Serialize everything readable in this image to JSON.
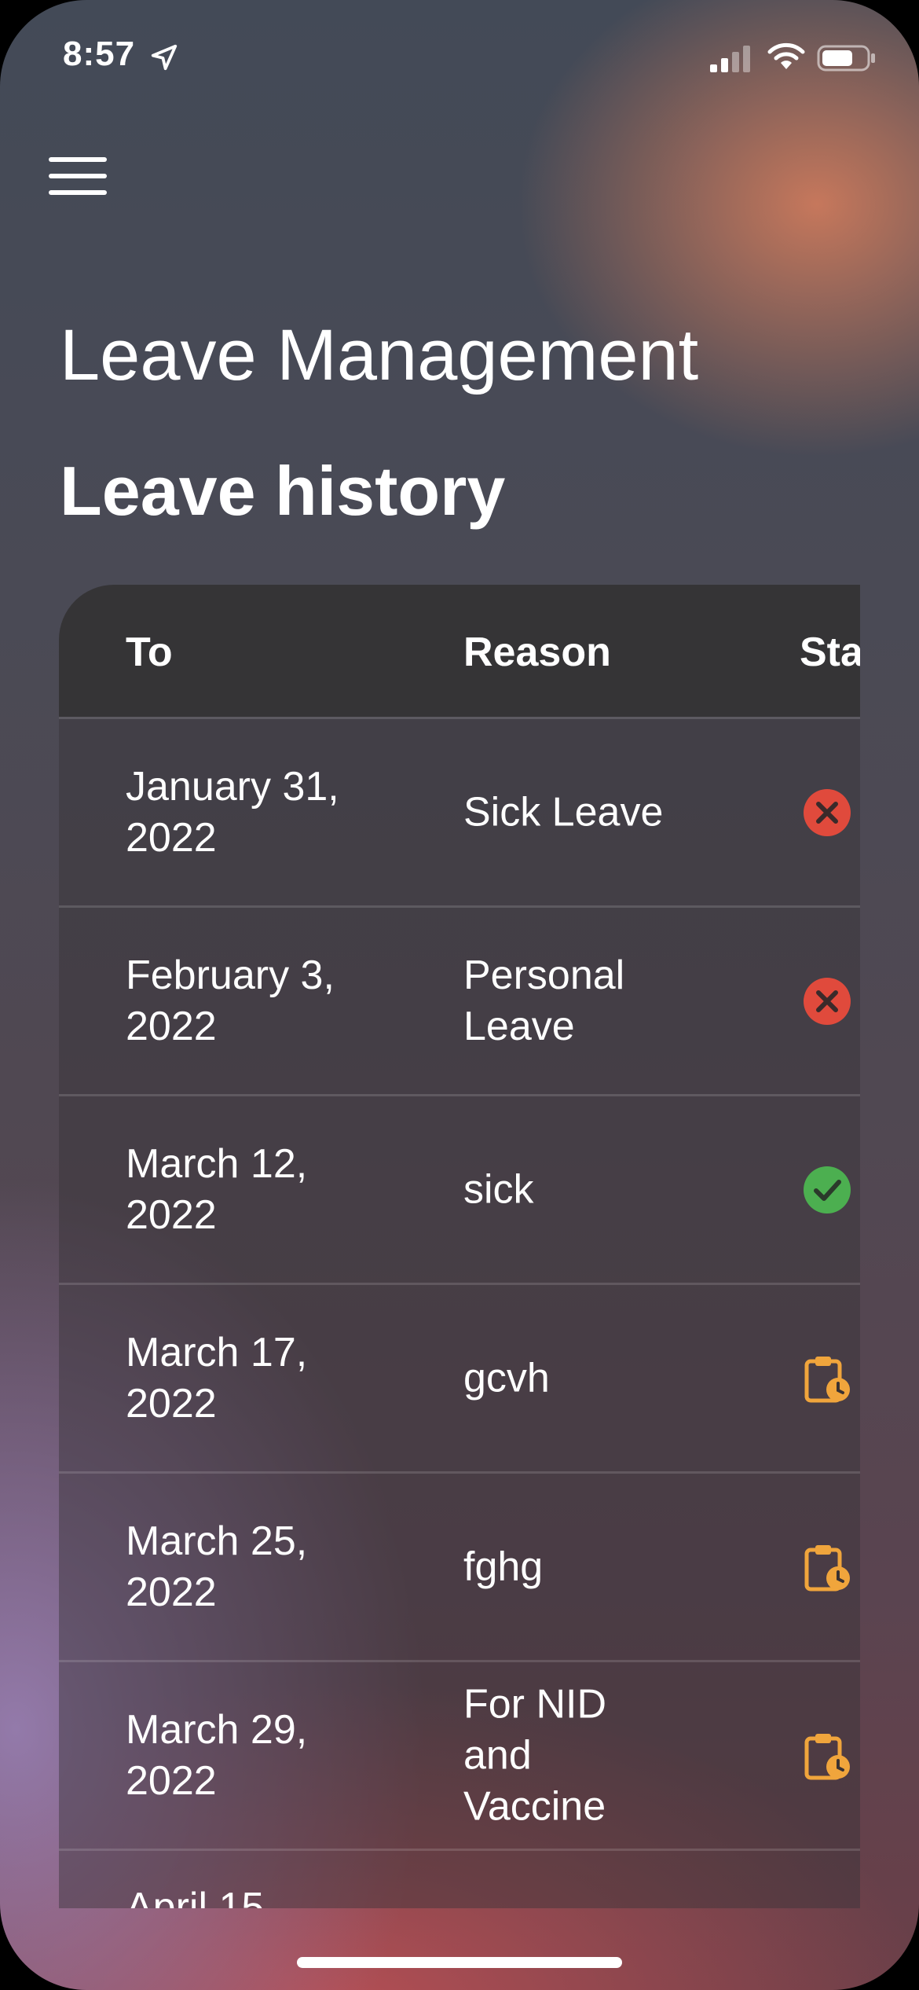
{
  "status_bar": {
    "time": "8:57"
  },
  "app": {
    "title": "Leave Management",
    "section_title": "Leave history"
  },
  "table": {
    "headers": [
      "To",
      "Reason",
      "Sta"
    ],
    "rows": [
      {
        "to": "January 31, 2022",
        "reason": "Sick Leave",
        "status": "rejected"
      },
      {
        "to": "February 3, 2022",
        "reason": "Personal Leave",
        "status": "rejected"
      },
      {
        "to": "March 12, 2022",
        "reason": "sick",
        "status": "approved"
      },
      {
        "to": "March 17, 2022",
        "reason": "gcvh",
        "status": "pending"
      },
      {
        "to": "March 25, 2022",
        "reason": "fghg",
        "status": "pending"
      },
      {
        "to": "March 29, 2022",
        "reason": "For NID and Vaccine",
        "status": "pending"
      },
      {
        "to": "April 15",
        "reason": "",
        "status": ""
      }
    ]
  },
  "icons": {
    "rejected": "close-circle-icon",
    "approved": "check-circle-icon",
    "pending": "clipboard-clock-icon"
  },
  "colors": {
    "rejected": "#e04a3c",
    "approved": "#4caf50",
    "pending": "#f0a53c"
  }
}
